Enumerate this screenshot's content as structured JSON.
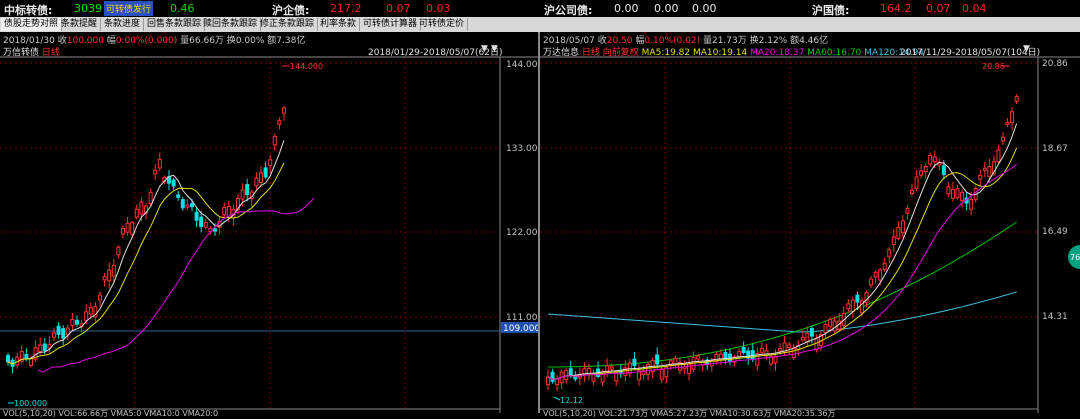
{
  "ticker": {
    "t1_label": "中标转债:",
    "t1_val": "3039",
    "t1_highlight": "可转债发行",
    "t1_val2": "0.46",
    "t2_label": "沪企债:",
    "t2_v1": "217.2",
    "t2_v2": "0.07",
    "t2_v3": "0.03",
    "t3_label": "沪公司债:",
    "t3_v1": "0.00",
    "t3_v2": "0.00",
    "t3_v3": "0.00",
    "t4_label": "沪国债:",
    "t4_v1": "164.2",
    "t4_v2": "0.07",
    "t4_v3": "0.04"
  },
  "tabs": [
    "债股走势对照",
    "条款提醒",
    "条款进度",
    "回售条款跟踪",
    "赎回条款跟踪",
    "修正条款跟踪",
    "利率条款",
    "可转债计算器",
    "可转债定价"
  ],
  "left": {
    "name": "万信转债",
    "period": "日线",
    "date": "2018/01/30",
    "close_label": "收",
    "close": "100.000",
    "chg_label": "幅",
    "chg": "0.00%(0.000)",
    "vol_label": "量",
    "vol": "66.66万",
    "turn_label": "换",
    "turn": "0.00%",
    "amt_label": "额",
    "amt": "7.38亿",
    "range": "2018/01/29-2018/05/07(62日)",
    "yaxis": [
      "144.000",
      "133.000",
      "122.000",
      "111.000"
    ],
    "current": "109.000",
    "high_label": "144.000",
    "low_label": "100.000",
    "bottom": "VOL(5,10,20) VOL:66.66万 VMA5:0 VMA10:0 VMA20:0"
  },
  "right": {
    "name": "万达信息",
    "period": "日线",
    "extra": "向前复权",
    "date": "2018/05/07",
    "close_label": "收",
    "close": "20.50",
    "chg_label": "幅",
    "chg": "0.10%(0.02)",
    "vol_label": "量",
    "vol": "21.73万",
    "turn_label": "换",
    "turn": "2.12%",
    "amt_label": "额",
    "amt": "4.46亿",
    "ma5": "MA5:19.82",
    "ma10": "MA10:19.14",
    "ma20": "MA20:18.37",
    "ma60": "MA60:16.70",
    "ma120": "MA120:14.94",
    "range": "2017/11/29-2018/05/07(104日)",
    "yaxis": [
      "20.86",
      "18.67",
      "16.49",
      "14.31"
    ],
    "high_label": "20.86",
    "low_label": "12.12",
    "bottom": "VOL(5,10,20) VOL:21.73万 VMA5:27.23万 VMA10:30.63万 VMA20:35.36万",
    "side_badge": "76"
  },
  "colors": {
    "up": "#ff3030",
    "down": "#00e0e0",
    "ma_yellow": "#e0e000",
    "ma_white": "#e0e0e0",
    "ma_purple": "#e000e0",
    "ma_green": "#00c000",
    "ma_cyan": "#40c0e0",
    "grid": "#7a0000"
  }
}
